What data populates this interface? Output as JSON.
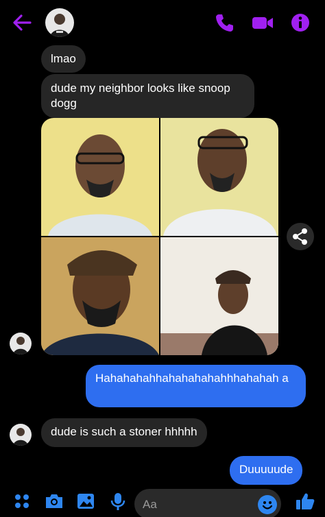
{
  "header": {
    "contact_avatar": "avatar-man-icon",
    "icons": [
      "back-arrow-icon",
      "phone-icon",
      "video-icon",
      "info-icon"
    ],
    "accent_color": "#a020f0"
  },
  "messages": [
    {
      "direction": "incoming",
      "text": "lmao"
    },
    {
      "direction": "incoming",
      "text": "dude my neighbor looks like snoop dogg"
    },
    {
      "direction": "incoming",
      "type": "photo-grid",
      "count": 4
    },
    {
      "direction": "outgoing",
      "text": "Hahahahahhahahahahahhhahahah a"
    },
    {
      "direction": "incoming",
      "text": "dude is such a stoner hhhhh"
    },
    {
      "direction": "outgoing",
      "text": "Duuuuude"
    }
  ],
  "composer": {
    "placeholder": "Aa",
    "icons": [
      "menu-dots-icon",
      "camera-icon",
      "gallery-icon",
      "mic-icon",
      "emoji-icon",
      "thumbs-up-icon"
    ]
  },
  "colors": {
    "outgoing_bubble": "#2e6ef0",
    "incoming_bubble": "#262626",
    "icon_blue": "#2e86f0"
  }
}
